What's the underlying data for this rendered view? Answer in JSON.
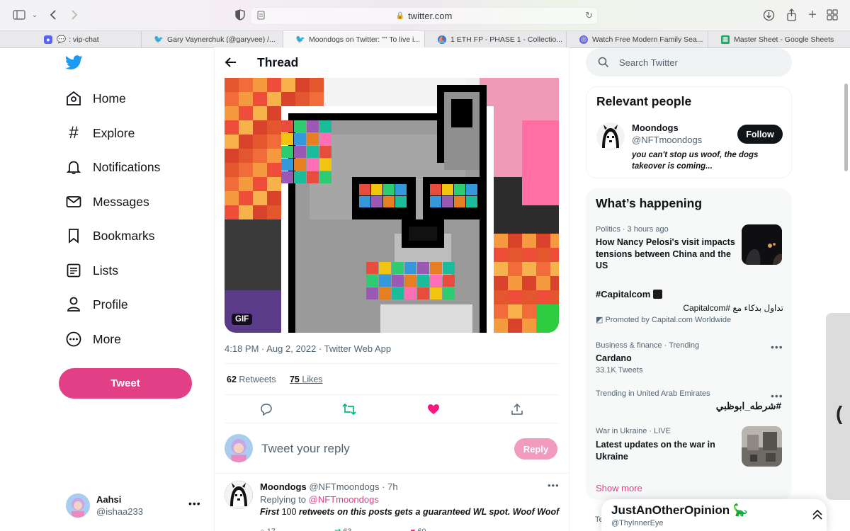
{
  "browser": {
    "url": "twitter.com",
    "tabs": [
      {
        "label": ": vip-chat",
        "icon": "discord-icon",
        "color": "#5865f2"
      },
      {
        "label": "Gary Vaynerchuk (@garyvee) /...",
        "icon": "twitter-icon",
        "color": "#1d9bf0"
      },
      {
        "label": "Moondogs on Twitter: \"\" To live i...",
        "icon": "twitter-icon",
        "color": "#1d9bf0"
      },
      {
        "label": "1 ETH FP - PHASE 1 - Collectio...",
        "icon": "opensea-icon",
        "color": "#2081e2"
      },
      {
        "label": "Watch Free Modern Family Sea...",
        "icon": "globe-icon",
        "color": "#6b6bd8"
      },
      {
        "label": "Master Sheet - Google Sheets",
        "icon": "sheets-icon",
        "color": "#1fa463"
      }
    ]
  },
  "nav": {
    "items": [
      {
        "label": "Home",
        "icon": "home-icon"
      },
      {
        "label": "Explore",
        "icon": "hashtag-icon"
      },
      {
        "label": "Notifications",
        "icon": "bell-icon"
      },
      {
        "label": "Messages",
        "icon": "envelope-icon"
      },
      {
        "label": "Bookmarks",
        "icon": "bookmark-icon"
      },
      {
        "label": "Lists",
        "icon": "list-icon"
      },
      {
        "label": "Profile",
        "icon": "person-icon"
      },
      {
        "label": "More",
        "icon": "more-circle-icon"
      }
    ],
    "tweet_button": "Tweet",
    "accent": "#e23f86"
  },
  "account": {
    "name": "Aahsi",
    "handle": "@ishaa233"
  },
  "thread": {
    "title": "Thread",
    "gif_label": "GIF",
    "timestamp": "4:18 PM · Aug 2, 2022 · Twitter Web App",
    "retweets": {
      "count": "62",
      "label": "Retweets"
    },
    "likes": {
      "count": "75",
      "label": "Likes"
    },
    "reply_placeholder": "Tweet your reply",
    "reply_button": "Reply"
  },
  "reply_tweet": {
    "name": "Moondogs",
    "handle": "@NFTmoondogs",
    "time": "· 7h",
    "replying_label": "Replying to",
    "replying_to": "@NFTmoondogs",
    "text_1": "First",
    "text_2": " 100 ",
    "text_3": "retweets on this posts gets a guaranteed WL spot. Woof Woof",
    "reply_count": "17",
    "retweet_count": "63",
    "like_count": "60"
  },
  "search": {
    "placeholder": "Search Twitter"
  },
  "relevant_people": {
    "title": "Relevant people",
    "person": {
      "name": "Moondogs",
      "handle": "@NFTmoondogs",
      "bio": "you can't stop us woof, the dogs takeover is coming...",
      "follow_label": "Follow"
    }
  },
  "whats_happening": {
    "title": "What’s happening",
    "trends": [
      {
        "meta": "Politics · 3 hours ago",
        "title": "How Nancy Pelosi's visit impacts tensions between China and the US"
      },
      {
        "meta": "",
        "title": "#Capitalcom",
        "sub_ar": "تداول بذكاء مع #Capitalcom",
        "promoted": "Promoted by Capital.com Worldwide"
      },
      {
        "meta": "Business & finance · Trending",
        "title": "Cardano",
        "sub": "33.1K Tweets"
      },
      {
        "meta": "Trending in United Arab Emirates",
        "title": "#شرطه_ابوظبي"
      },
      {
        "meta": "War in Ukraine · LIVE",
        "title": "Latest updates on the war in Ukraine"
      }
    ],
    "show_more": "Show more"
  },
  "partial_footer": "Te",
  "messages_drawer": {
    "name": "JustAnOtherOpinion 🦕",
    "handle": "@ThyInnerEye"
  },
  "colors": {
    "twitter_blue": "#1d9bf0",
    "like_pink": "#f91880",
    "retweet_green": "#00ba7c",
    "pink_button": "#e23f86"
  }
}
